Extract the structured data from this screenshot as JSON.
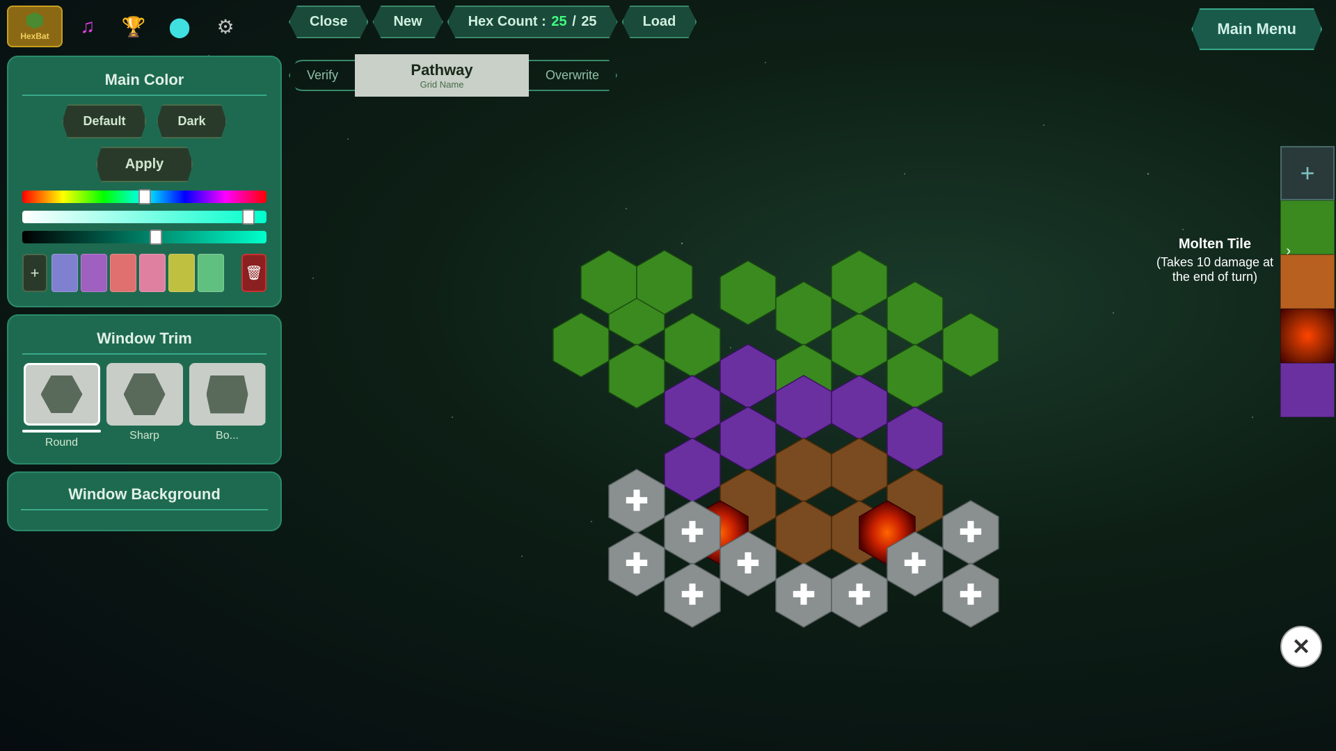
{
  "app": {
    "title": "HexBat"
  },
  "toolbar": {
    "close_label": "Close",
    "new_label": "New",
    "hex_count_label": "Hex Count :",
    "hex_count_current": "25",
    "hex_count_max": "25",
    "load_label": "Load",
    "main_menu_label": "Main Menu",
    "verify_label": "Verify",
    "overwrite_label": "Overwrite",
    "grid_name_label": "Grid Name",
    "grid_name_value": "Pathway"
  },
  "left_panel": {
    "main_color": {
      "title": "Main Color",
      "default_label": "Default",
      "dark_label": "Dark",
      "apply_label": "Apply",
      "palette_add_label": "+",
      "palette_delete_label": "🗑",
      "swatches": [
        "#8080d0",
        "#a060c0",
        "#e07070",
        "#e080a0",
        "#c0c040",
        "#60c080"
      ]
    },
    "window_trim": {
      "title": "Window Trim",
      "options": [
        {
          "id": "round",
          "label": "Round",
          "selected": true
        },
        {
          "id": "sharp",
          "label": "Sharp",
          "selected": false
        },
        {
          "id": "box",
          "label": "Bo...",
          "selected": false
        }
      ]
    },
    "window_background": {
      "title": "Window Background"
    }
  },
  "right_panel": {
    "zoom_plus_label": "+",
    "tiles": [
      {
        "id": "green",
        "color": "#3a8a20"
      },
      {
        "id": "orange",
        "color": "#b86020"
      },
      {
        "id": "molten",
        "label": "Molten Tile",
        "description": "(Takes 10 damage at the end of turn)"
      },
      {
        "id": "purple",
        "color": "#6a30a0"
      }
    ],
    "close_label": "✕"
  },
  "molten_info": {
    "title": "Molten Tile",
    "description": "(Takes 10 damage at\nthe end of turn)"
  }
}
